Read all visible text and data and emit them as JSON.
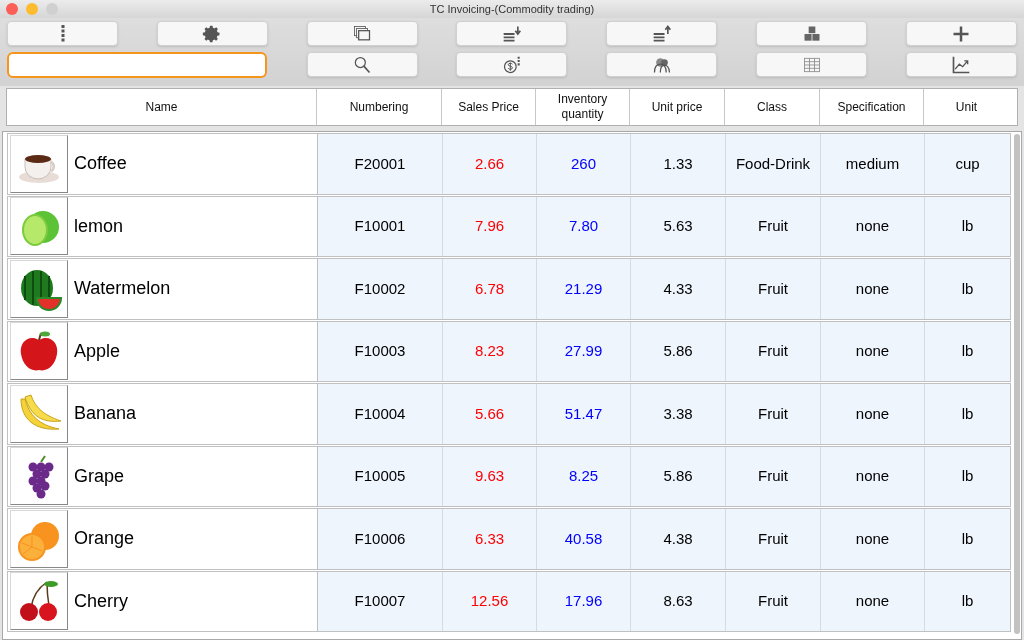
{
  "window": {
    "title": "TC Invoicing-(Commodity trading)"
  },
  "table": {
    "columns": [
      "Name",
      "Numbering",
      "Sales Price",
      "Inventory quantity",
      "Unit price",
      "Class",
      "Specification",
      "Unit"
    ],
    "rows": [
      {
        "kind": "coffee",
        "name": "Coffee",
        "numbering": "F20001",
        "sales_price": "2.66",
        "inventory": "260",
        "unit_price": "1.33",
        "class": "Food-Drink",
        "specification": "medium",
        "unit": "cup"
      },
      {
        "kind": "lime",
        "name": "lemon",
        "numbering": "F10001",
        "sales_price": "7.96",
        "inventory": "7.80",
        "unit_price": "5.63",
        "class": "Fruit",
        "specification": "none",
        "unit": "lb"
      },
      {
        "kind": "watermelon",
        "name": "Watermelon",
        "numbering": "F10002",
        "sales_price": "6.78",
        "inventory": "21.29",
        "unit_price": "4.33",
        "class": "Fruit",
        "specification": "none",
        "unit": "lb"
      },
      {
        "kind": "apple",
        "name": "Apple",
        "numbering": "F10003",
        "sales_price": "8.23",
        "inventory": "27.99",
        "unit_price": "5.86",
        "class": "Fruit",
        "specification": "none",
        "unit": "lb"
      },
      {
        "kind": "banana",
        "name": "Banana",
        "numbering": "F10004",
        "sales_price": "5.66",
        "inventory": "51.47",
        "unit_price": "3.38",
        "class": "Fruit",
        "specification": "none",
        "unit": "lb"
      },
      {
        "kind": "grape",
        "name": "Grape",
        "numbering": "F10005",
        "sales_price": "9.63",
        "inventory": "8.25",
        "unit_price": "5.86",
        "class": "Fruit",
        "specification": "none",
        "unit": "lb"
      },
      {
        "kind": "orange",
        "name": "Orange",
        "numbering": "F10006",
        "sales_price": "6.33",
        "inventory": "40.58",
        "unit_price": "4.38",
        "class": "Fruit",
        "specification": "none",
        "unit": "lb"
      },
      {
        "kind": "cherry",
        "name": "Cherry",
        "numbering": "F10007",
        "sales_price": "12.56",
        "inventory": "17.96",
        "unit_price": "8.63",
        "class": "Fruit",
        "specification": "none",
        "unit": "lb"
      }
    ]
  }
}
